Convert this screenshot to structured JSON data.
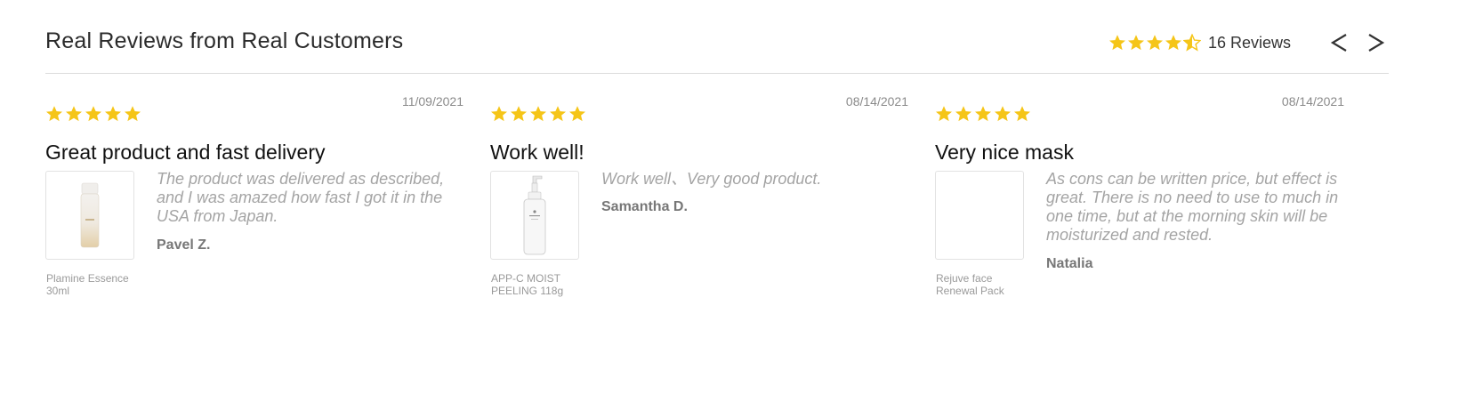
{
  "header": {
    "title": "Real Reviews from Real Customers",
    "rating_stars": 4.5,
    "review_count_label": "16 Reviews",
    "prev_label": "<",
    "next_label": ">"
  },
  "colors": {
    "star": "#f5c518",
    "divider": "#dcdcdc",
    "review_text": "#a4a4a4"
  },
  "reviews": [
    {
      "stars": 5,
      "date": "11/09/2021",
      "title": "Great product and fast delivery",
      "body": "The product was delivered as described, and I was amazed how fast I got it in the USA from Japan.",
      "author": "Pavel Z.",
      "product": "Plamine Essence 30ml",
      "image": "essence-bottle-image"
    },
    {
      "stars": 5,
      "date": "08/14/2021",
      "title": "Work well!",
      "body": "Work well、Very good product.",
      "author": "Samantha D.",
      "product": "APP-C MOIST PEELING 118g",
      "image": "pump-bottle-image"
    },
    {
      "stars": 5,
      "date": "08/14/2021",
      "title": "Very nice mask",
      "body": "As cons can be written price, but effect is great. There is no need to use to much in one time, but at the morning skin will be moisturized and rested.",
      "author": "Natalia",
      "product": "Rejuve face Renewal Pack",
      "image": "empty-image"
    }
  ]
}
